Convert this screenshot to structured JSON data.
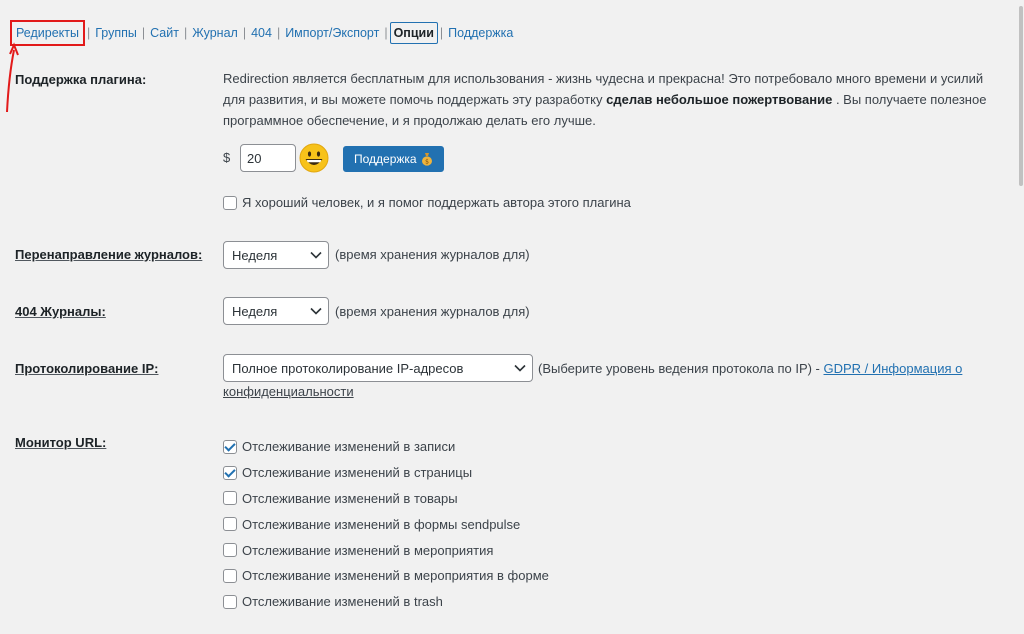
{
  "nav": {
    "items": [
      {
        "label": "Редиректы",
        "highlighted": true
      },
      {
        "label": "Группы"
      },
      {
        "label": "Сайт"
      },
      {
        "label": "Журнал"
      },
      {
        "label": "404"
      },
      {
        "label": "Импорт/Экспорт"
      },
      {
        "label": "Опции",
        "current": true
      },
      {
        "label": "Поддержка"
      }
    ],
    "separator": "|",
    "highlight_color": "#e21a1a"
  },
  "support": {
    "label": "Поддержка плагина:",
    "text_1": "Redirection является бесплатным для использования - жизнь чудесна и прекрасна! Это потребовало много времени и усилий для развития, и вы можете помочь поддержать эту разработку",
    "text_bold": "сделав небольшое пожертвование",
    "text_2": ". Вы получаете полезное программное обеспечение, и я продолжаю делать его лучше.",
    "currency": "$",
    "amount": "20",
    "smiley_icon": "grinning-face-icon",
    "button_label": "Поддержка",
    "button_icon": "money-bag-icon",
    "checkbox_label": "Я хороший человек, и я помог поддержать автора этого плагина",
    "checkbox_checked": false
  },
  "redirect_logs": {
    "label": "Перенаправление журналов:",
    "value": "Неделя",
    "hint": "(время хранения журналов для)"
  },
  "logs_404": {
    "label": "404 Журналы:",
    "value": "Неделя",
    "hint": "(время хранения журналов для)"
  },
  "ip_logging": {
    "label": "Протоколирование IP:",
    "value": "Полное протоколирование IP-адресов",
    "hint": "(Выберите уровень ведения протокола по IP) -",
    "link_1": "GDPR / Информация о",
    "link_2": "конфиденциальности"
  },
  "url_monitor": {
    "label": "Монитор URL:",
    "items": [
      {
        "label": "Отслеживание изменений в записи",
        "checked": true
      },
      {
        "label": "Отслеживание изменений в страницы",
        "checked": true
      },
      {
        "label": "Отслеживание изменений в товары",
        "checked": false
      },
      {
        "label": "Отслеживание изменений в формы sendpulse",
        "checked": false
      },
      {
        "label": "Отслеживание изменений в мероприятия",
        "checked": false
      },
      {
        "label": "Отслеживание изменений в мероприятия в форме",
        "checked": false
      },
      {
        "label": "Отслеживание изменений в trash",
        "checked": false
      }
    ]
  },
  "colors": {
    "link": "#2271b1",
    "primary_button": "#2271b1",
    "background": "#f1f1f1"
  }
}
